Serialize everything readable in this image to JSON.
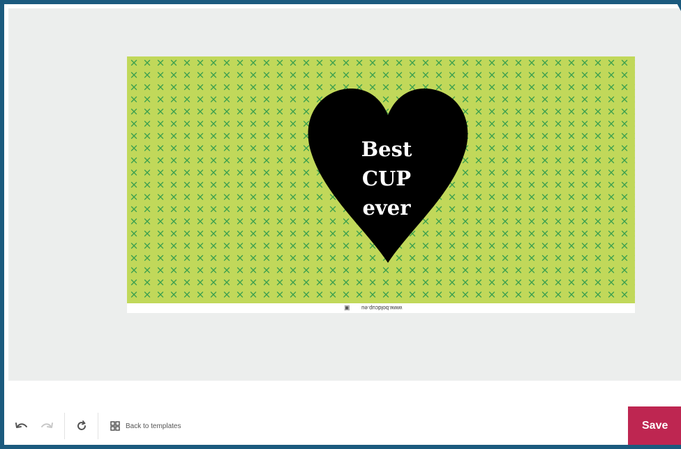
{
  "theme": {
    "frame_color": "#1b5a7e",
    "canvas_bg": "#eceeed",
    "pattern_bg": "#c1d85a",
    "pattern_mark": "#3da04e",
    "heart": "#000000",
    "save_bg": "#be2651"
  },
  "design": {
    "heart_text": [
      "Best",
      "CUP",
      "ever"
    ],
    "footer_url": "www.boldcup.eu"
  },
  "toolbar": {
    "undo_icon": "undo-icon",
    "redo_icon": "redo-icon",
    "reset_icon": "refresh-icon",
    "back_icon": "grid-icon",
    "back_label": "Back to templates",
    "save_label": "Save"
  }
}
